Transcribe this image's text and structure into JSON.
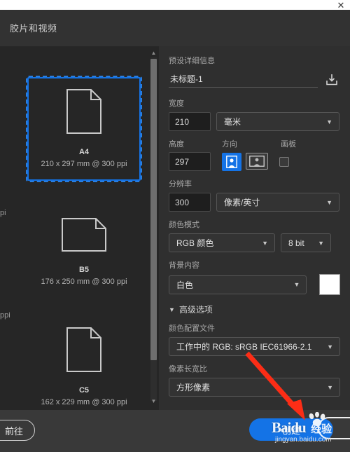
{
  "window": {
    "close_label": "✕",
    "accent_color": "#1473e6",
    "panel_bg": "#2f2f2f",
    "dialog_bg": "#2b2b2b"
  },
  "header": {
    "title": "胶片和视频"
  },
  "presets": {
    "items": [
      {
        "name": "A4",
        "dimensions": "210 x 297 mm @ 300 ppi",
        "orientation": "portrait",
        "selected": true
      },
      {
        "name": "B5",
        "dimensions": "176 x 250 mm @ 300 ppi",
        "orientation": "landscape",
        "selected": false
      },
      {
        "name": "C5",
        "dimensions": "162 x 229 mm @ 300 ppi",
        "orientation": "portrait",
        "selected": false
      }
    ],
    "edge_fragments": [
      "pi",
      "ppi",
      "ppi"
    ]
  },
  "details": {
    "section_label": "预设详细信息",
    "preset_name": {
      "value": "未标题-1",
      "placeholder": "未标题-1"
    },
    "save_preset_icon": "download-icon",
    "width": {
      "label": "宽度",
      "value": "210",
      "unit": "毫米"
    },
    "height": {
      "label": "高度",
      "value": "297"
    },
    "orientation": {
      "label": "方向",
      "portrait_icon": "portrait-icon",
      "landscape_icon": "landscape-icon",
      "selected": "portrait"
    },
    "artboard": {
      "label": "画板",
      "checked": false
    },
    "resolution": {
      "label": "分辨率",
      "value": "300",
      "unit": "像素/英寸"
    },
    "color_mode": {
      "label": "颜色模式",
      "value": "RGB 颜色",
      "depth": "8 bit"
    },
    "background": {
      "label": "背景内容",
      "value": "白色",
      "swatch_color": "#ffffff"
    },
    "advanced": {
      "label": "高级选项",
      "expanded": true,
      "color_profile": {
        "label": "颜色配置文件",
        "value": "工作中的 RGB: sRGB IEC61966-2.1"
      },
      "pixel_aspect": {
        "label": "像素长宽比",
        "value": "方形像素"
      }
    }
  },
  "footer": {
    "goto_label": "前往",
    "create_label": "创建"
  },
  "annotation": {
    "arrow_color": "#fc2d16"
  },
  "watermark": {
    "logo": "Baidu",
    "suffix": "经验",
    "url": "jingyan.baidu.com"
  }
}
